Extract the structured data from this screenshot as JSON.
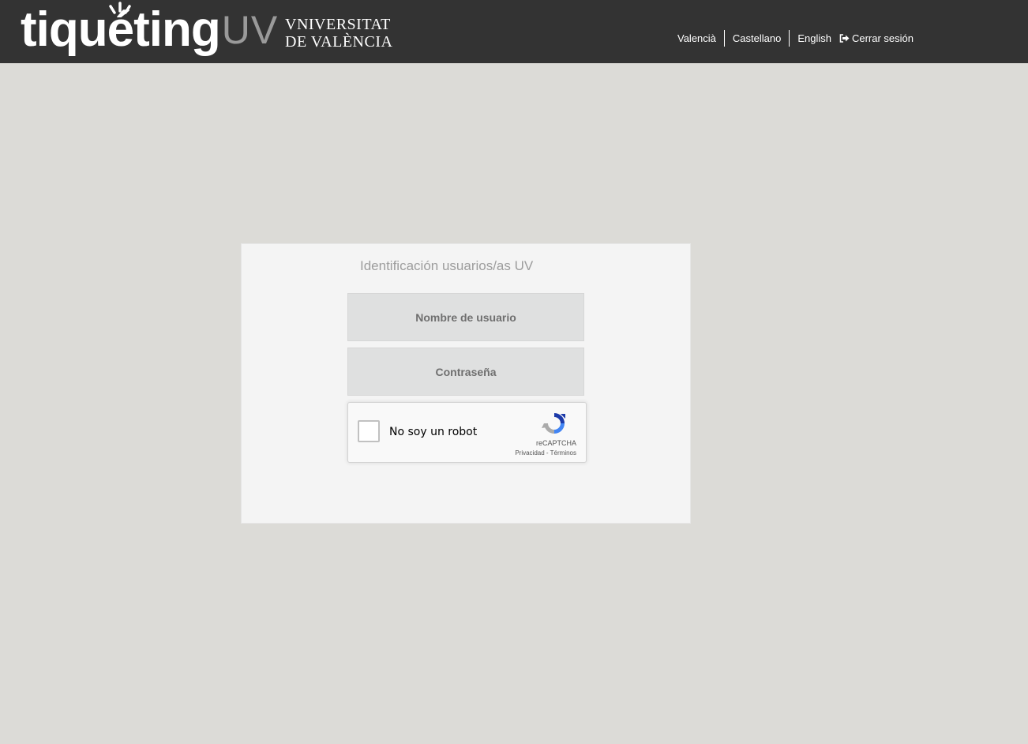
{
  "header": {
    "logo_main": "tiquéting",
    "logo_suffix": "UV",
    "university_line1": "VNIVERSITAT",
    "university_line2": "DE VALÈNCIA",
    "languages": [
      "Valencià",
      "Castellano",
      "English"
    ],
    "logout_label": "Cerrar sesión",
    "logout_icon": "sign-out-icon"
  },
  "login": {
    "title": "Identificación usuarios/as UV",
    "username_placeholder": "Nombre de usuario",
    "password_placeholder": "Contraseña"
  },
  "captcha": {
    "label": "No soy un robot",
    "brand": "reCAPTCHA",
    "privacy": "Privacidad",
    "separator": " - ",
    "terms": "Términos"
  },
  "colors": {
    "header_bg": "#333333",
    "page_bg": "#dcdbd7",
    "card_bg": "#f4f4f4",
    "field_bg": "#dfe0e0"
  }
}
